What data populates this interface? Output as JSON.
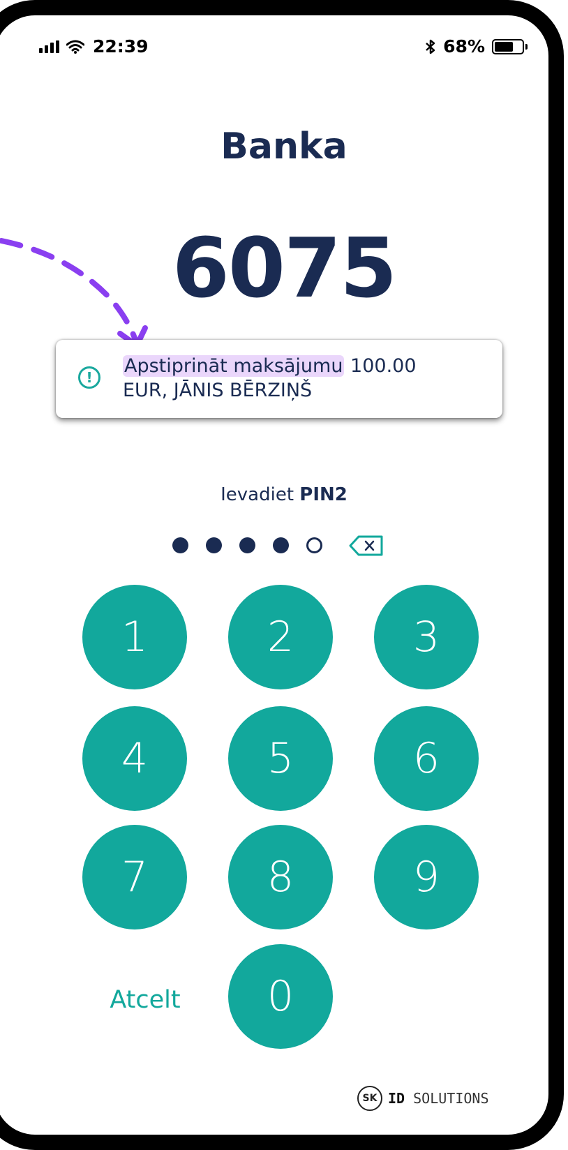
{
  "status_bar": {
    "time": "22:39",
    "battery_percent": "68%",
    "battery_level": 0.68,
    "icons": [
      "signal-icon",
      "wifi-icon",
      "bluetooth-icon",
      "battery-icon"
    ]
  },
  "header": {
    "title": "Banka",
    "verification_code": "6075"
  },
  "notice": {
    "icon": "info-icon",
    "highlight_text": "Apstiprināt maksājumu",
    "amount_text": " 100.00",
    "second_line": "EUR, JĀNIS BĒRZIŅŠ"
  },
  "pin": {
    "label_prefix": "Ievadiet",
    "label_bold": "PIN2",
    "entered": 4,
    "length": 5
  },
  "keypad": {
    "keys": [
      "1",
      "2",
      "3",
      "4",
      "5",
      "6",
      "7",
      "8",
      "9",
      "0"
    ],
    "cancel_label": "Atcelt"
  },
  "branding": {
    "logo_mark": "SK",
    "logo_text_bold": "ID",
    "logo_text": " SOLUTIONS"
  },
  "colors": {
    "primary": "#1a2b52",
    "accent": "#12a89c",
    "highlight": "#ead6fb",
    "arrow": "#8a3ff0"
  }
}
